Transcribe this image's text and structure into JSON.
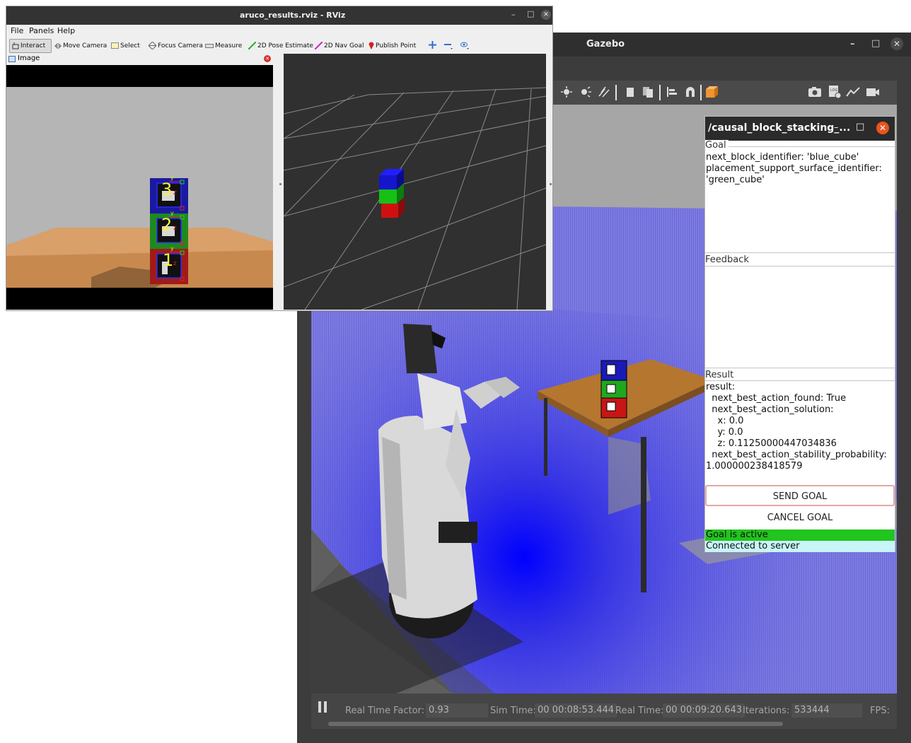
{
  "gazebo": {
    "title": "Gazebo",
    "bottom_bar": {
      "rtf_label": "Real Time Factor:",
      "rtf_value": "0.93",
      "sim_time_label": "Sim Time:",
      "sim_time_value": "00 00:08:53.444",
      "real_time_label": "Real Time:",
      "real_time_value": "00 00:09:20.643",
      "iterations_label": "Iterations:",
      "iterations_value": "533444",
      "fps_label": "FPS:"
    }
  },
  "action_client": {
    "title": "/causal_block_stacking_...",
    "goal_label": "Goal",
    "goal_lines": [
      "next_block_identifier: 'blue_cube'",
      "placement_support_surface_identifier:",
      "'green_cube'"
    ],
    "feedback_label": "Feedback",
    "result_label": "Result",
    "result_lines": [
      "result:",
      "  next_best_action_found: True",
      "  next_best_action_solution:",
      "    x: 0.0",
      "    y: 0.0",
      "    z: 0.11250000447034836",
      "  next_best_action_stability_probability:",
      "1.000000238418579"
    ],
    "send_goal_label": "SEND GOAL",
    "cancel_goal_label": "CANCEL GOAL",
    "status_goal": "Goal is active",
    "status_connection": "Connected to server",
    "colors": {
      "goal_active": "#22c41e",
      "connected": "#c8f5f8"
    }
  },
  "rviz": {
    "title": "aruco_results.rviz - RViz",
    "menu": [
      "File",
      "Panels",
      "Help"
    ],
    "tools": [
      "Interact",
      "Move Camera",
      "Select",
      "Focus Camera",
      "Measure",
      "2D Pose Estimate",
      "2D Nav Goal",
      "Publish Point"
    ],
    "image_panel_title": "Image",
    "marker_labels": [
      "3",
      "2",
      "1"
    ]
  }
}
